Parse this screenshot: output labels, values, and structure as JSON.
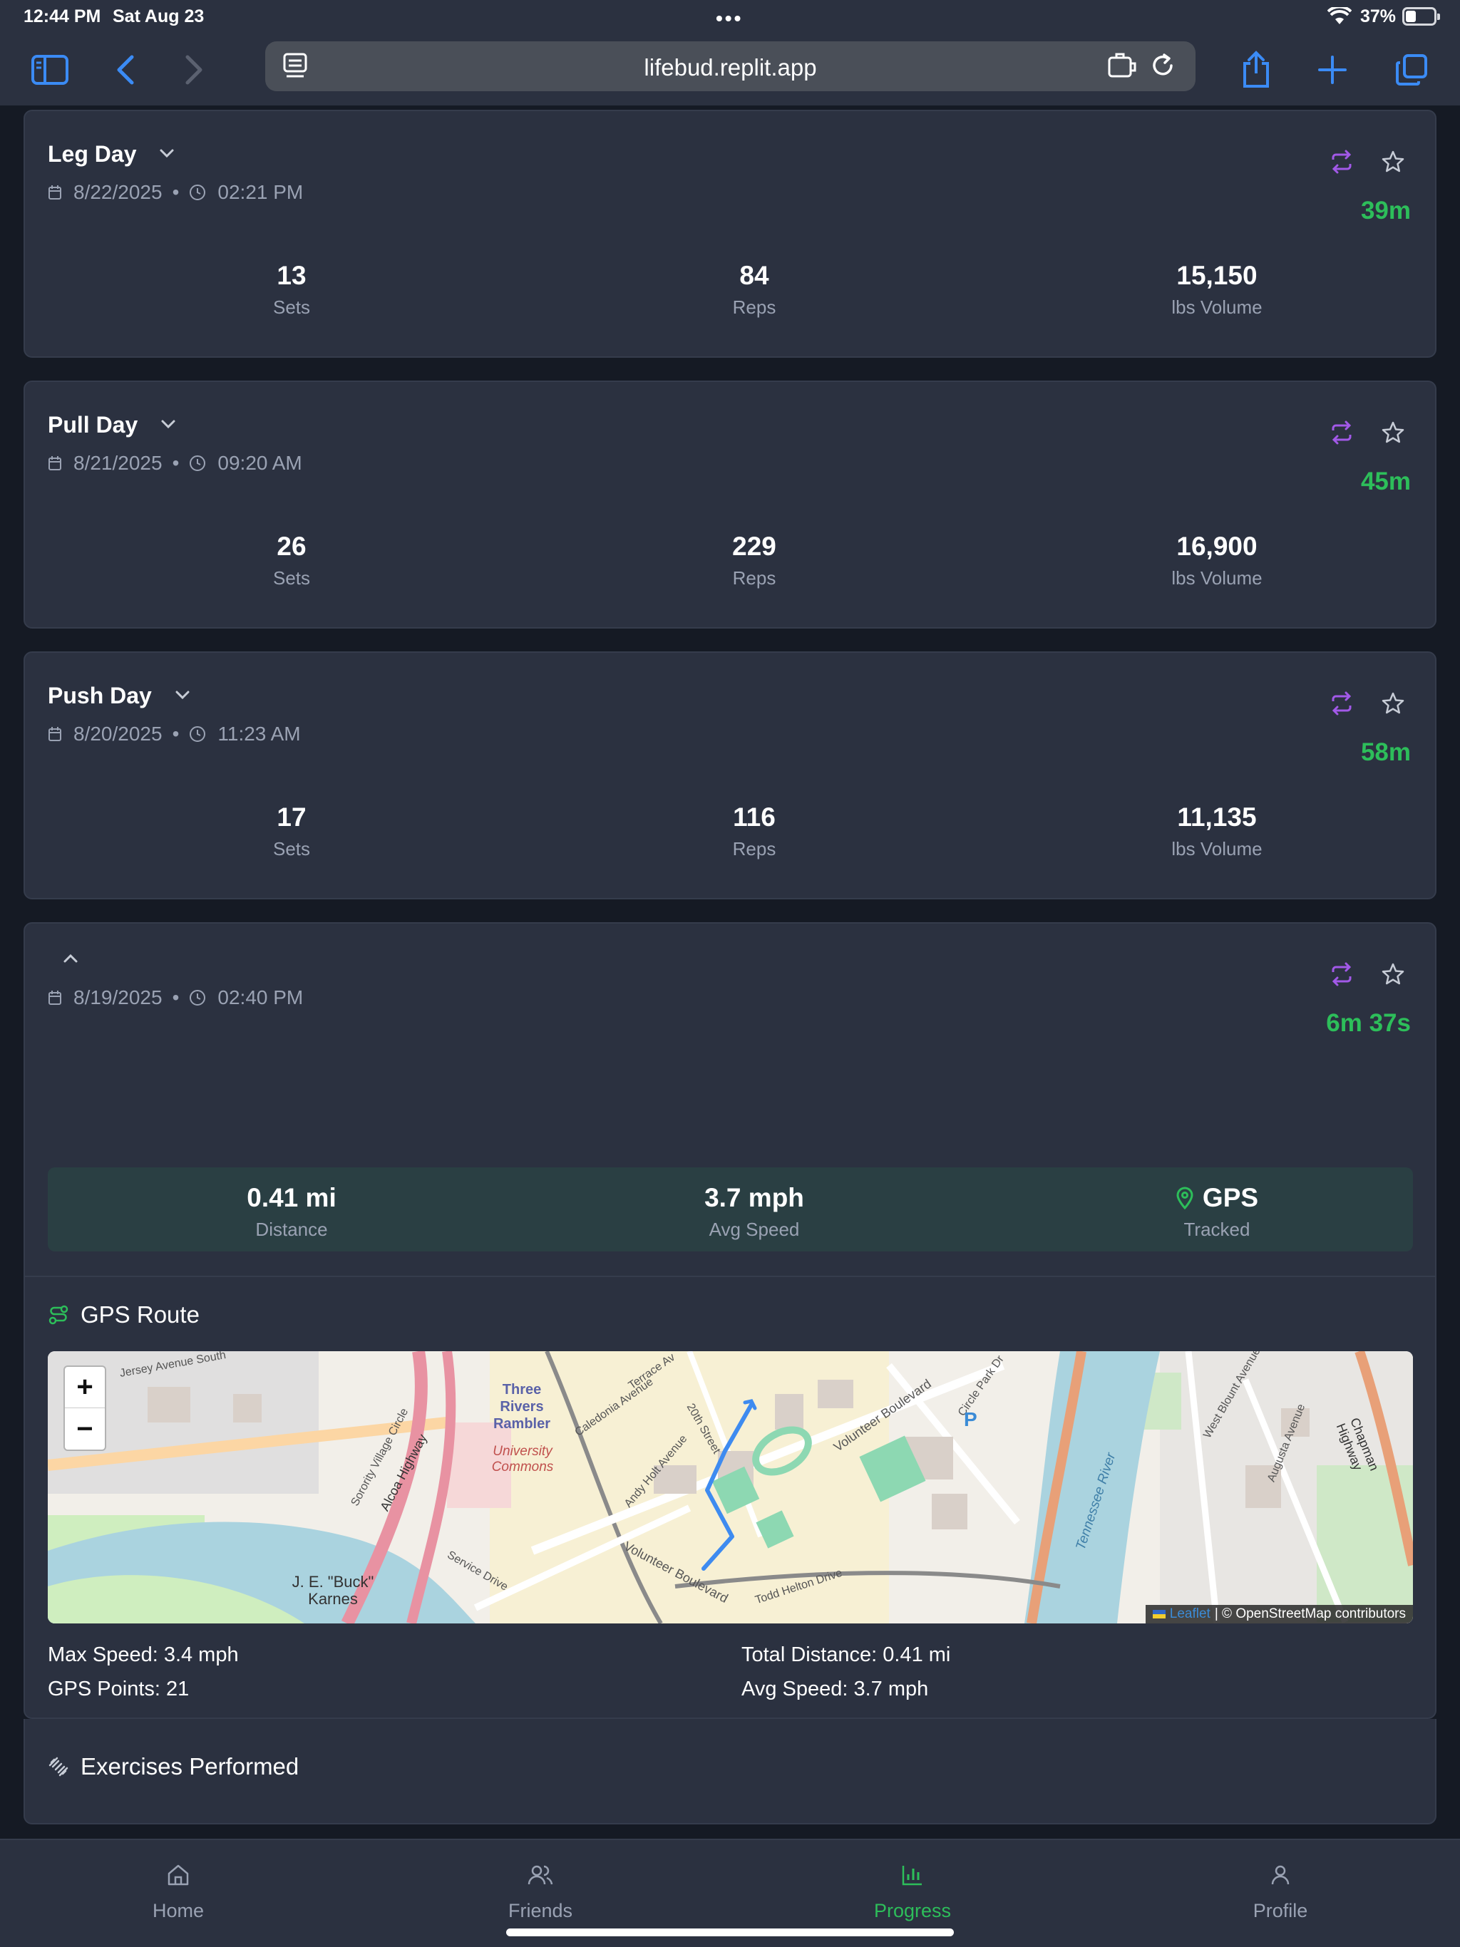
{
  "status_bar": {
    "time": "12:44 PM",
    "date": "Sat Aug 23",
    "battery": "37%"
  },
  "browser": {
    "url": "lifebud.replit.app"
  },
  "workouts": [
    {
      "title": "Leg Day",
      "date": "8/22/2025",
      "time": "02:21 PM",
      "duration": "39m",
      "stats": [
        {
          "value": "13",
          "label": "Sets"
        },
        {
          "value": "84",
          "label": "Reps"
        },
        {
          "value": "15,150",
          "label": "lbs Volume"
        }
      ]
    },
    {
      "title": "Pull Day",
      "date": "8/21/2025",
      "time": "09:20 AM",
      "duration": "45m",
      "stats": [
        {
          "value": "26",
          "label": "Sets"
        },
        {
          "value": "229",
          "label": "Reps"
        },
        {
          "value": "16,900",
          "label": "lbs Volume"
        }
      ]
    },
    {
      "title": "Push Day",
      "date": "8/20/2025",
      "time": "11:23 AM",
      "duration": "58m",
      "stats": [
        {
          "value": "17",
          "label": "Sets"
        },
        {
          "value": "116",
          "label": "Reps"
        },
        {
          "value": "11,135",
          "label": "lbs Volume"
        }
      ]
    }
  ],
  "run": {
    "date": "8/19/2025",
    "time": "02:40 PM",
    "duration": "6m 37s",
    "stats": [
      {
        "value": "0.41 mi",
        "label": "Distance"
      },
      {
        "value": "3.7 mph",
        "label": "Avg Speed"
      },
      {
        "value": "GPS",
        "label": "Tracked"
      }
    ],
    "gps_route_title": "GPS Route",
    "map": {
      "zoom_in": "+",
      "zoom_out": "−",
      "attribution_leaflet": "Leaflet",
      "attribution_osm": "| © OpenStreetMap contributors",
      "labels": {
        "three_rivers": "Three Rivers Rambler",
        "university_commons": "University Commons",
        "karnes": "J. E. \"Buck\" Karnes",
        "volunteer_blvd": "Volunteer Boulevard",
        "volunteer_blvd_2": "Volunteer Boulevard",
        "tennessee_river": "Tennessee River",
        "chapman_hwy": "Chapman Highway",
        "alcoa_hwy": "Alcoa Highway",
        "todd_helton": "Todd Helton Drive",
        "andy_holt": "Andy Holt Avenue",
        "caledonia": "Caledonia Avenue",
        "twentieth": "20th Street",
        "sorority": "Sorority Village Circle",
        "service": "Service Drive",
        "jersey": "Jersey Avenue South",
        "west_blount": "West Blount Avenue",
        "augusta": "Augusta Avenue",
        "circle_park": "Circle Park Dr",
        "terrace": "Terrace Av",
        "parking": "P"
      }
    },
    "details": {
      "max_speed": "Max Speed: 3.4 mph",
      "gps_points": "GPS Points: 21",
      "total_distance": "Total Distance: 0.41 mi",
      "avg_speed": "Avg Speed: 3.7 mph"
    },
    "exercises_title": "Exercises Performed"
  },
  "nav": [
    {
      "label": "Home",
      "icon": "home-icon"
    },
    {
      "label": "Friends",
      "icon": "friends-icon"
    },
    {
      "label": "Progress",
      "icon": "progress-icon",
      "active": true
    },
    {
      "label": "Profile",
      "icon": "profile-icon"
    }
  ],
  "colors": {
    "accent_green": "#2dbe5a",
    "accent_purple": "#a259e8",
    "card_bg": "#2b3140",
    "page_bg": "#151a24"
  }
}
